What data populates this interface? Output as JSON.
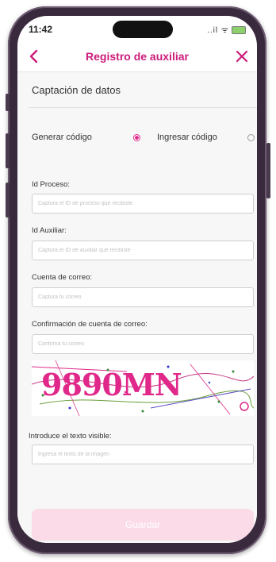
{
  "status_bar": {
    "time": "11:42",
    "signal_icons": "..il ᯤ"
  },
  "nav": {
    "title": "Registro de auxiliar",
    "back_icon": "chevron-left-icon",
    "close_icon": "close-icon"
  },
  "section": {
    "title": "Captación de datos"
  },
  "radio": {
    "generate_label": "Generar código",
    "enter_label": "Ingresar código",
    "selected": "generate"
  },
  "fields": {
    "process_id": {
      "label": "Id Proceso:",
      "placeholder": "Captura el ID de proceso que recibiste"
    },
    "aux_id": {
      "label": "Id Auxiliar:",
      "placeholder": "Captura el ID de auxiliar que recibiste"
    },
    "email": {
      "label": "Cuenta de correo:",
      "placeholder": "Captura tu correo"
    },
    "email_confirm": {
      "label": "Confirmación de cuenta de correo:",
      "placeholder": "Confirma tu correo"
    },
    "captcha_input": {
      "label": "Introduce el texto visible:",
      "placeholder": "Ingresa el texto de la imagen"
    }
  },
  "captcha": {
    "text": "9890MN"
  },
  "submit": {
    "label": "Guardar"
  },
  "colors": {
    "accent": "#cc1b7a",
    "captcha": "#e0288a",
    "button_disabled": "#fbdbe8"
  }
}
